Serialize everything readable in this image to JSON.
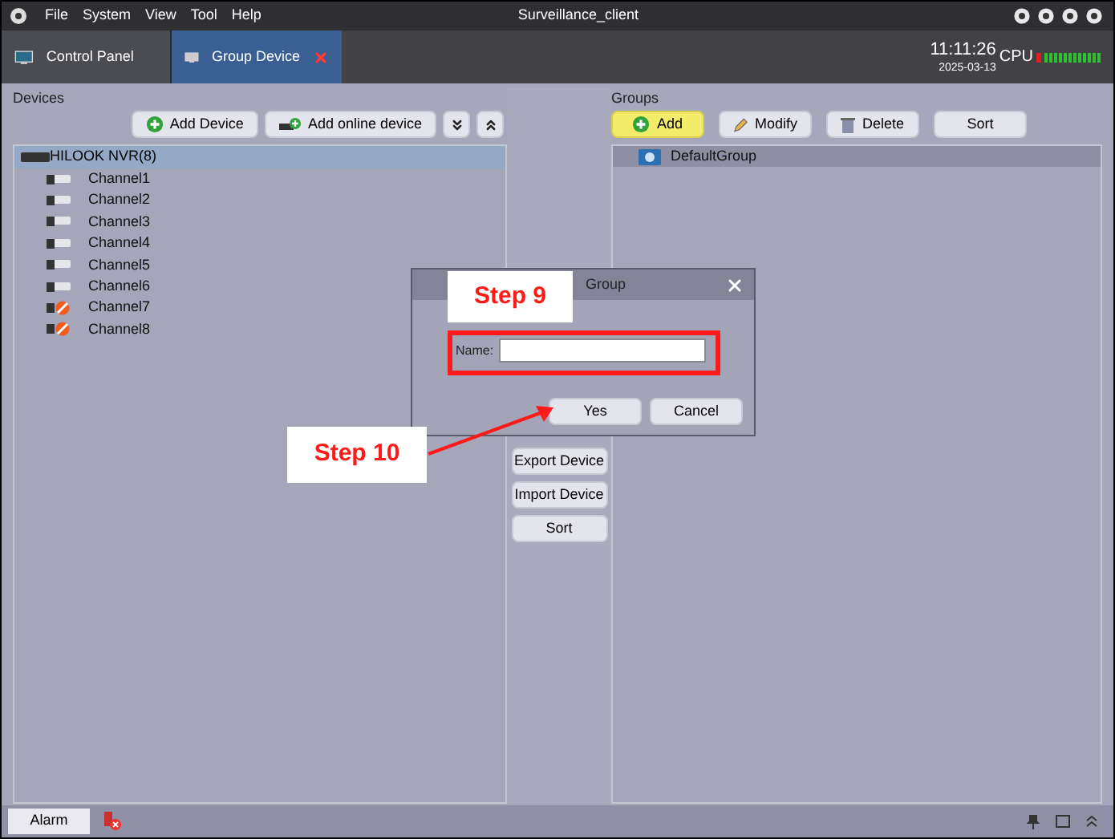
{
  "window": {
    "title": "Surveillance_client",
    "menu": [
      "File",
      "System",
      "View",
      "Tool",
      "Help"
    ]
  },
  "tabs": [
    {
      "label": "Control Panel",
      "selected": false,
      "closable": false
    },
    {
      "label": "Group Device",
      "selected": true,
      "closable": true
    }
  ],
  "clock": {
    "time": "11:11:26",
    "date": "2025-03-13",
    "cpu_label": "CPU"
  },
  "devices": {
    "title": "Devices",
    "buttons": [
      {
        "kind": "add",
        "label": "Add Device"
      },
      {
        "kind": "online",
        "label": "Add online device"
      },
      {
        "kind": "down"
      },
      {
        "kind": "up"
      }
    ],
    "tree": [
      {
        "label": "HILOOK NVR(8)",
        "selected": true,
        "children": [
          {
            "label": "Channel1",
            "offline": false
          },
          {
            "label": "Channel2",
            "offline": false
          },
          {
            "label": "Channel3",
            "offline": false
          },
          {
            "label": "Channel4",
            "offline": false
          },
          {
            "label": "Channel5",
            "offline": false
          },
          {
            "label": "Channel6",
            "offline": false
          },
          {
            "label": "Channel7",
            "offline": true
          },
          {
            "label": "Channel8",
            "offline": true
          }
        ]
      }
    ]
  },
  "middle_buttons": [
    "Export Device",
    "Import Device",
    "Sort"
  ],
  "groups": {
    "title": "Groups",
    "buttons": [
      {
        "kind": "add",
        "label": "Add",
        "highlighted": true
      },
      {
        "kind": "modify",
        "label": "Modify",
        "highlighted": false
      },
      {
        "kind": "delete",
        "label": "Delete",
        "highlighted": false
      },
      {
        "kind": "plain",
        "label": "Sort",
        "highlighted": false
      }
    ],
    "tree": [
      {
        "label": "DefaultGroup",
        "selected": true
      }
    ]
  },
  "dialog": {
    "title": "Group",
    "name_label": "Name:",
    "buttons": [
      "Yes",
      "Cancel"
    ]
  },
  "annotations": [
    {
      "text": "Step 9"
    },
    {
      "text": "Step 10"
    }
  ],
  "status_bar": {
    "alarm": "Alarm"
  }
}
